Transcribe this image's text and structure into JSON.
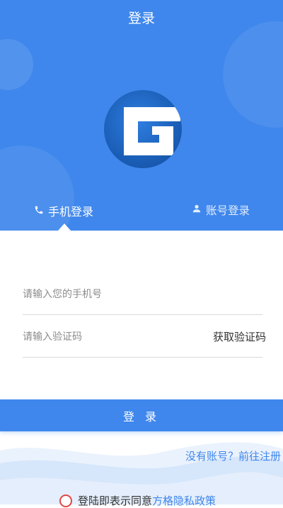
{
  "header": {
    "title": "登录",
    "background_color": "#3f87ec",
    "logo_icon": "g-logo-icon"
  },
  "tabs": [
    {
      "label": "手机登录",
      "icon": "phone-icon",
      "active": true
    },
    {
      "label": "账号登录",
      "icon": "user-icon",
      "active": false
    }
  ],
  "form": {
    "phone_placeholder": "请输入您的手机号",
    "phone_value": "",
    "code_placeholder": "请输入验证码",
    "code_value": "",
    "get_code_label": "获取验证码"
  },
  "login_button": {
    "label": "登 录",
    "color": "#3f87ec"
  },
  "register_link": "没有账号？前往注册",
  "agreement": {
    "text": "登陆即表示同意",
    "link": "方格隐私政策",
    "checked": false
  }
}
